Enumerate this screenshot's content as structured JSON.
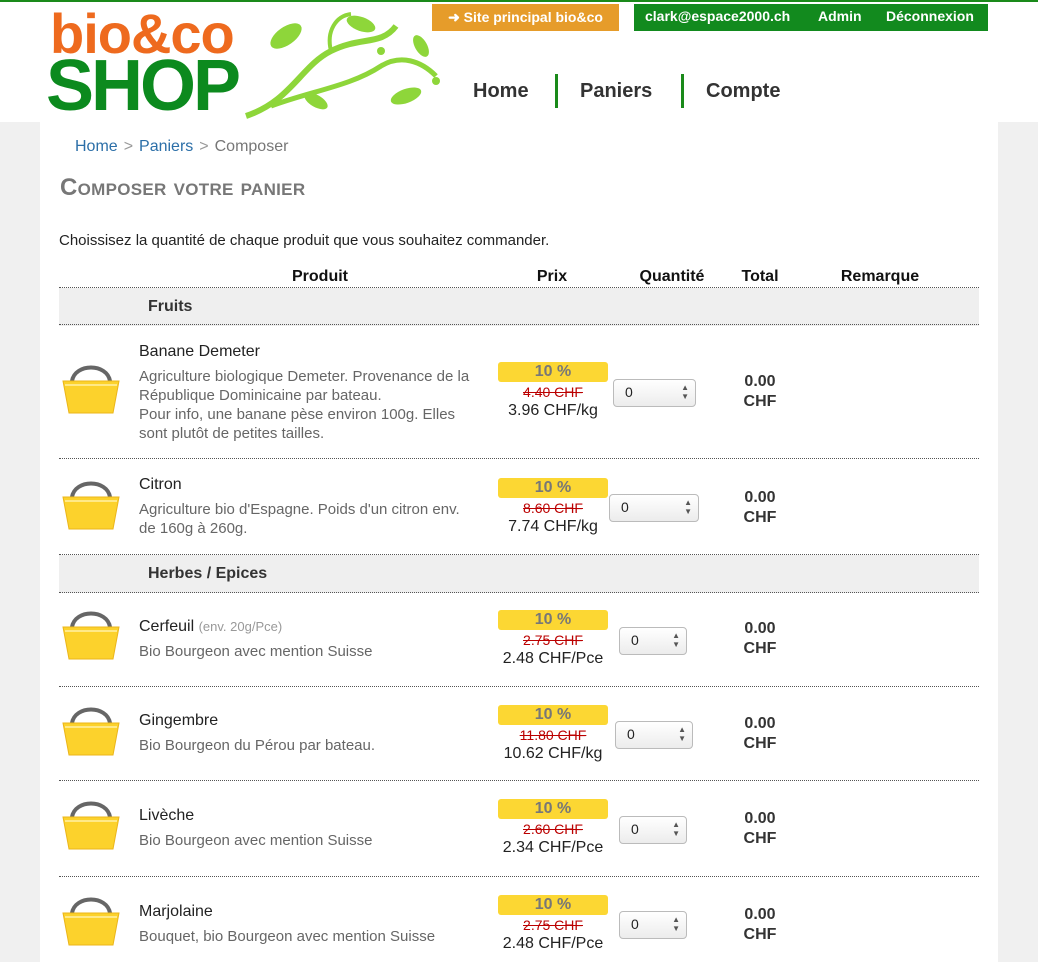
{
  "colors": {
    "brand_green": "#128a1e",
    "accent_orange": "#e69c2a",
    "discount_yellow": "#fcd733",
    "old_price_red": "#b00000"
  },
  "header": {
    "logo_top": "bio&co",
    "logo_bottom": "SHOP",
    "site_button": "➜ Site principal bio&co",
    "user_email": "clark@espace2000.ch",
    "admin": "Admin",
    "logout": "Déconnexion",
    "nav": [
      "Home",
      "Paniers",
      "Compte"
    ]
  },
  "breadcrumb": [
    "Home",
    "Paniers",
    "Composer"
  ],
  "title": "Composer votre panier",
  "intro": "Choissisez la quantité de chaque produit que vous souhaitez commander.",
  "columns": [
    "Produit",
    "Prix",
    "Quantité",
    "Total",
    "Remarque"
  ],
  "categories": [
    "Fruits",
    "Herbes / Epices"
  ],
  "products": [
    {
      "name": "Banane Demeter",
      "hint": "",
      "desc": [
        "Agriculture biologique Demeter. Provenance de la",
        "République Dominicaine par bateau.",
        "Pour info, une banane pèse environ 100g. Elles",
        "sont plutôt de petites tailles."
      ],
      "discount": "10 %",
      "old_price": "4.40 CHF",
      "price": "3.96 CHF/kg",
      "qty": "0",
      "total": "0.00",
      "currency": "CHF"
    },
    {
      "name": "Citron",
      "hint": "",
      "desc": [
        "Agriculture bio d'Espagne. Poids d'un citron env.",
        "de 160g à 260g."
      ],
      "discount": "10 %",
      "old_price": "8.60 CHF",
      "price": "7.74 CHF/kg",
      "qty": "0",
      "total": "0.00",
      "currency": "CHF"
    },
    {
      "name": "Cerfeuil",
      "hint": "(env. 20g/Pce)",
      "desc": [
        "Bio Bourgeon avec mention Suisse"
      ],
      "discount": "10 %",
      "old_price": "2.75 CHF",
      "price": "2.48 CHF/Pce",
      "qty": "0",
      "total": "0.00",
      "currency": "CHF"
    },
    {
      "name": "Gingembre",
      "hint": "",
      "desc": [
        "Bio Bourgeon du Pérou par bateau."
      ],
      "discount": "10 %",
      "old_price": "11.80 CHF",
      "price": "10.62 CHF/kg",
      "qty": "0",
      "total": "0.00",
      "currency": "CHF"
    },
    {
      "name": "Livèche",
      "hint": "",
      "desc": [
        "Bio Bourgeon avec mention Suisse"
      ],
      "discount": "10 %",
      "old_price": "2.60 CHF",
      "price": "2.34 CHF/Pce",
      "qty": "0",
      "total": "0.00",
      "currency": "CHF"
    },
    {
      "name": "Marjolaine",
      "hint": "",
      "desc": [
        "Bouquet, bio Bourgeon avec mention Suisse"
      ],
      "discount": "10 %",
      "old_price": "2.75 CHF",
      "price": "2.48 CHF/Pce",
      "qty": "0",
      "total": "0.00",
      "currency": "CHF"
    }
  ]
}
